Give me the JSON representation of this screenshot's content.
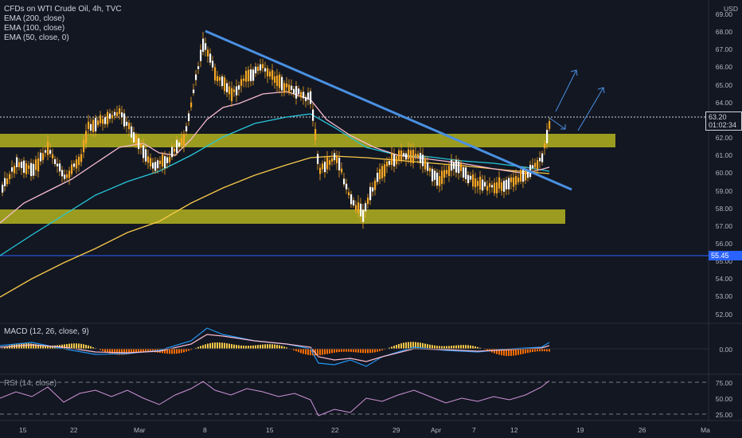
{
  "header": {
    "symbol_line": "CFDs on WTI Crude Oil, 4h, TVC",
    "ema_labels": [
      "EMA (200, close)",
      "EMA (100, close)",
      "EMA (50, close, 0)"
    ]
  },
  "price_axis": {
    "currency": "USD",
    "ticks": [
      "69.00",
      "68.00",
      "67.00",
      "66.00",
      "65.00",
      "64.00",
      "63.00",
      "62.00",
      "61.00",
      "60.00",
      "59.00",
      "58.00",
      "57.00",
      "56.00",
      "55.00",
      "54.00",
      "53.00",
      "52.00"
    ],
    "current_price": "63.20",
    "countdown": "01:02:34",
    "marked_level": "55.45"
  },
  "macd_panel": {
    "label": "MACD (12, 26, close, 9)",
    "ticks": [
      "0.00"
    ]
  },
  "rsi_panel": {
    "label": "RSI (14, close)",
    "ticks": [
      "75.00",
      "50.00",
      "25.00"
    ]
  },
  "time_axis": {
    "labels": [
      "15",
      "22",
      "Mar",
      "8",
      "15",
      "22",
      "29",
      "Apr",
      "7",
      "12",
      "19",
      "26",
      "Ma"
    ]
  },
  "colors": {
    "background": "#131722",
    "zone_fill": "#b4b41e",
    "trendline": "#4a90e2",
    "ema200": "#f7c948",
    "ema100": "#26c6da",
    "ema50": "#f8bbd0",
    "candle": "#f5a623",
    "level_line": "#2962ff",
    "price_tag": "#131722",
    "level_tag": "#2962ff"
  }
}
